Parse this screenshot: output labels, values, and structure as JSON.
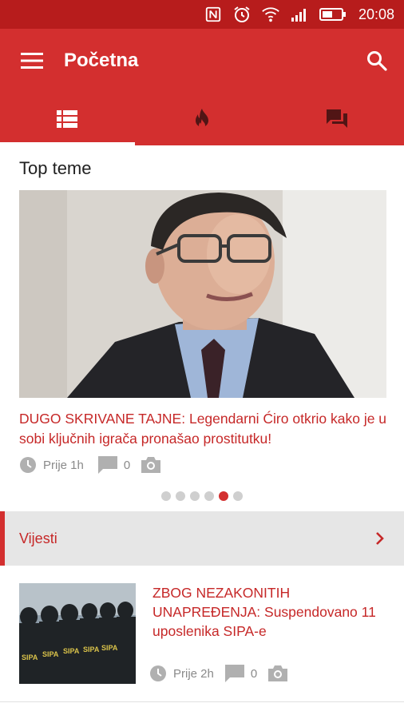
{
  "status_bar": {
    "time": "20:08"
  },
  "app_bar": {
    "title": "Početna"
  },
  "tabs": [
    {
      "icon": "list-icon",
      "active": true
    },
    {
      "icon": "fire-icon",
      "active": false
    },
    {
      "icon": "chat-icon",
      "active": false
    }
  ],
  "top_section": {
    "heading": "Top teme",
    "hero": {
      "title": "DUGO SKRIVANE TAJNE: Legendarni Ćiro otkrio kako je u sobi ključnih igrača pronašao prostitutku!",
      "time": "Prije 1h",
      "comments": "0"
    },
    "carousel": {
      "count": 6,
      "active_index": 4
    }
  },
  "category": {
    "label": "Vijesti"
  },
  "articles": [
    {
      "title": "ZBOG NEZAKONITIH UNAPREĐENJA: Suspendovano 11 uposlenika SIPA-e",
      "time": "Prije 2h",
      "comments": "0"
    }
  ],
  "colors": {
    "primary": "#d32f2f",
    "primary_dark": "#b71c1c",
    "accent_text": "#c62828"
  }
}
